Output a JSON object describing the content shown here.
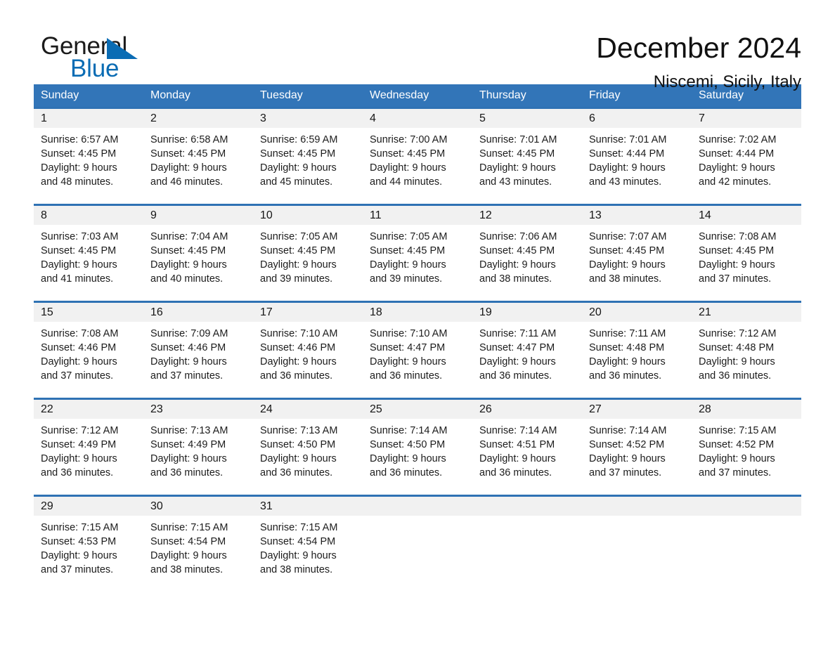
{
  "brand": {
    "word_one": "General",
    "word_two": "Blue",
    "triangle_color": "#0a6cb4",
    "text_color": "#1b1b1b"
  },
  "header": {
    "title": "December 2024",
    "subtitle": "Niscemi, Sicily, Italy"
  },
  "theme": {
    "header_blue": "#3275b8",
    "rule_blue": "#2f72b4",
    "daynum_band": "#f1f1f1",
    "page_background": "#ffffff"
  },
  "calendar": {
    "weekday_headers": [
      "Sunday",
      "Monday",
      "Tuesday",
      "Wednesday",
      "Thursday",
      "Friday",
      "Saturday"
    ],
    "weeks": [
      {
        "days": [
          {
            "num": "1",
            "sunrise": "Sunrise: 6:57 AM",
            "sunset": "Sunset: 4:45 PM",
            "daylight_1": "Daylight: 9 hours",
            "daylight_2": "and 48 minutes."
          },
          {
            "num": "2",
            "sunrise": "Sunrise: 6:58 AM",
            "sunset": "Sunset: 4:45 PM",
            "daylight_1": "Daylight: 9 hours",
            "daylight_2": "and 46 minutes."
          },
          {
            "num": "3",
            "sunrise": "Sunrise: 6:59 AM",
            "sunset": "Sunset: 4:45 PM",
            "daylight_1": "Daylight: 9 hours",
            "daylight_2": "and 45 minutes."
          },
          {
            "num": "4",
            "sunrise": "Sunrise: 7:00 AM",
            "sunset": "Sunset: 4:45 PM",
            "daylight_1": "Daylight: 9 hours",
            "daylight_2": "and 44 minutes."
          },
          {
            "num": "5",
            "sunrise": "Sunrise: 7:01 AM",
            "sunset": "Sunset: 4:45 PM",
            "daylight_1": "Daylight: 9 hours",
            "daylight_2": "and 43 minutes."
          },
          {
            "num": "6",
            "sunrise": "Sunrise: 7:01 AM",
            "sunset": "Sunset: 4:44 PM",
            "daylight_1": "Daylight: 9 hours",
            "daylight_2": "and 43 minutes."
          },
          {
            "num": "7",
            "sunrise": "Sunrise: 7:02 AM",
            "sunset": "Sunset: 4:44 PM",
            "daylight_1": "Daylight: 9 hours",
            "daylight_2": "and 42 minutes."
          }
        ]
      },
      {
        "days": [
          {
            "num": "8",
            "sunrise": "Sunrise: 7:03 AM",
            "sunset": "Sunset: 4:45 PM",
            "daylight_1": "Daylight: 9 hours",
            "daylight_2": "and 41 minutes."
          },
          {
            "num": "9",
            "sunrise": "Sunrise: 7:04 AM",
            "sunset": "Sunset: 4:45 PM",
            "daylight_1": "Daylight: 9 hours",
            "daylight_2": "and 40 minutes."
          },
          {
            "num": "10",
            "sunrise": "Sunrise: 7:05 AM",
            "sunset": "Sunset: 4:45 PM",
            "daylight_1": "Daylight: 9 hours",
            "daylight_2": "and 39 minutes."
          },
          {
            "num": "11",
            "sunrise": "Sunrise: 7:05 AM",
            "sunset": "Sunset: 4:45 PM",
            "daylight_1": "Daylight: 9 hours",
            "daylight_2": "and 39 minutes."
          },
          {
            "num": "12",
            "sunrise": "Sunrise: 7:06 AM",
            "sunset": "Sunset: 4:45 PM",
            "daylight_1": "Daylight: 9 hours",
            "daylight_2": "and 38 minutes."
          },
          {
            "num": "13",
            "sunrise": "Sunrise: 7:07 AM",
            "sunset": "Sunset: 4:45 PM",
            "daylight_1": "Daylight: 9 hours",
            "daylight_2": "and 38 minutes."
          },
          {
            "num": "14",
            "sunrise": "Sunrise: 7:08 AM",
            "sunset": "Sunset: 4:45 PM",
            "daylight_1": "Daylight: 9 hours",
            "daylight_2": "and 37 minutes."
          }
        ]
      },
      {
        "days": [
          {
            "num": "15",
            "sunrise": "Sunrise: 7:08 AM",
            "sunset": "Sunset: 4:46 PM",
            "daylight_1": "Daylight: 9 hours",
            "daylight_2": "and 37 minutes."
          },
          {
            "num": "16",
            "sunrise": "Sunrise: 7:09 AM",
            "sunset": "Sunset: 4:46 PM",
            "daylight_1": "Daylight: 9 hours",
            "daylight_2": "and 37 minutes."
          },
          {
            "num": "17",
            "sunrise": "Sunrise: 7:10 AM",
            "sunset": "Sunset: 4:46 PM",
            "daylight_1": "Daylight: 9 hours",
            "daylight_2": "and 36 minutes."
          },
          {
            "num": "18",
            "sunrise": "Sunrise: 7:10 AM",
            "sunset": "Sunset: 4:47 PM",
            "daylight_1": "Daylight: 9 hours",
            "daylight_2": "and 36 minutes."
          },
          {
            "num": "19",
            "sunrise": "Sunrise: 7:11 AM",
            "sunset": "Sunset: 4:47 PM",
            "daylight_1": "Daylight: 9 hours",
            "daylight_2": "and 36 minutes."
          },
          {
            "num": "20",
            "sunrise": "Sunrise: 7:11 AM",
            "sunset": "Sunset: 4:48 PM",
            "daylight_1": "Daylight: 9 hours",
            "daylight_2": "and 36 minutes."
          },
          {
            "num": "21",
            "sunrise": "Sunrise: 7:12 AM",
            "sunset": "Sunset: 4:48 PM",
            "daylight_1": "Daylight: 9 hours",
            "daylight_2": "and 36 minutes."
          }
        ]
      },
      {
        "days": [
          {
            "num": "22",
            "sunrise": "Sunrise: 7:12 AM",
            "sunset": "Sunset: 4:49 PM",
            "daylight_1": "Daylight: 9 hours",
            "daylight_2": "and 36 minutes."
          },
          {
            "num": "23",
            "sunrise": "Sunrise: 7:13 AM",
            "sunset": "Sunset: 4:49 PM",
            "daylight_1": "Daylight: 9 hours",
            "daylight_2": "and 36 minutes."
          },
          {
            "num": "24",
            "sunrise": "Sunrise: 7:13 AM",
            "sunset": "Sunset: 4:50 PM",
            "daylight_1": "Daylight: 9 hours",
            "daylight_2": "and 36 minutes."
          },
          {
            "num": "25",
            "sunrise": "Sunrise: 7:14 AM",
            "sunset": "Sunset: 4:50 PM",
            "daylight_1": "Daylight: 9 hours",
            "daylight_2": "and 36 minutes."
          },
          {
            "num": "26",
            "sunrise": "Sunrise: 7:14 AM",
            "sunset": "Sunset: 4:51 PM",
            "daylight_1": "Daylight: 9 hours",
            "daylight_2": "and 36 minutes."
          },
          {
            "num": "27",
            "sunrise": "Sunrise: 7:14 AM",
            "sunset": "Sunset: 4:52 PM",
            "daylight_1": "Daylight: 9 hours",
            "daylight_2": "and 37 minutes."
          },
          {
            "num": "28",
            "sunrise": "Sunrise: 7:15 AM",
            "sunset": "Sunset: 4:52 PM",
            "daylight_1": "Daylight: 9 hours",
            "daylight_2": "and 37 minutes."
          }
        ]
      },
      {
        "days": [
          {
            "num": "29",
            "sunrise": "Sunrise: 7:15 AM",
            "sunset": "Sunset: 4:53 PM",
            "daylight_1": "Daylight: 9 hours",
            "daylight_2": "and 37 minutes."
          },
          {
            "num": "30",
            "sunrise": "Sunrise: 7:15 AM",
            "sunset": "Sunset: 4:54 PM",
            "daylight_1": "Daylight: 9 hours",
            "daylight_2": "and 38 minutes."
          },
          {
            "num": "31",
            "sunrise": "Sunrise: 7:15 AM",
            "sunset": "Sunset: 4:54 PM",
            "daylight_1": "Daylight: 9 hours",
            "daylight_2": "and 38 minutes."
          },
          {
            "num": "",
            "sunrise": "",
            "sunset": "",
            "daylight_1": "",
            "daylight_2": ""
          },
          {
            "num": "",
            "sunrise": "",
            "sunset": "",
            "daylight_1": "",
            "daylight_2": ""
          },
          {
            "num": "",
            "sunrise": "",
            "sunset": "",
            "daylight_1": "",
            "daylight_2": ""
          },
          {
            "num": "",
            "sunrise": "",
            "sunset": "",
            "daylight_1": "",
            "daylight_2": ""
          }
        ]
      }
    ]
  }
}
